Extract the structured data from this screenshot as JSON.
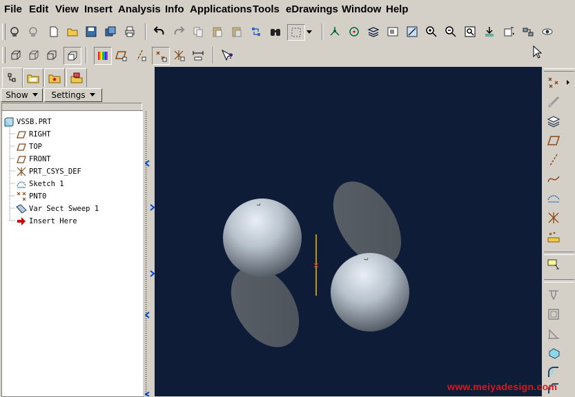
{
  "menu": {
    "file": "File",
    "edit": "Edit",
    "view": "View",
    "insert": "Insert",
    "analysis": "Analysis",
    "info": "Info",
    "applications": "Applications",
    "tools": "Tools",
    "edrawings": "eDrawings",
    "window": "Window",
    "help": "Help"
  },
  "left_panel": {
    "show_label": "Show",
    "settings_label": "Settings"
  },
  "model_tree": {
    "items": [
      {
        "label": "VSSB.PRT",
        "icon": "part-icon"
      },
      {
        "label": "RIGHT",
        "icon": "datum-plane-icon"
      },
      {
        "label": "TOP",
        "icon": "datum-plane-icon"
      },
      {
        "label": "FRONT",
        "icon": "datum-plane-icon"
      },
      {
        "label": "PRT_CSYS_DEF",
        "icon": "csys-icon"
      },
      {
        "label": "Sketch 1",
        "icon": "sketch-icon"
      },
      {
        "label": "PNT0",
        "icon": "datum-point-icon"
      },
      {
        "label": "Var Sect Sweep 1",
        "icon": "sweep-icon"
      },
      {
        "label": "Insert Here",
        "icon": "insert-arrow-icon"
      }
    ]
  },
  "watermark": "www.meiyadesign.com",
  "colors": {
    "viewport_bg": "#0f1c38",
    "ui_bg": "#d4d0c8",
    "datum_color": "#8b4513",
    "watermark_color": "#e0141e"
  }
}
